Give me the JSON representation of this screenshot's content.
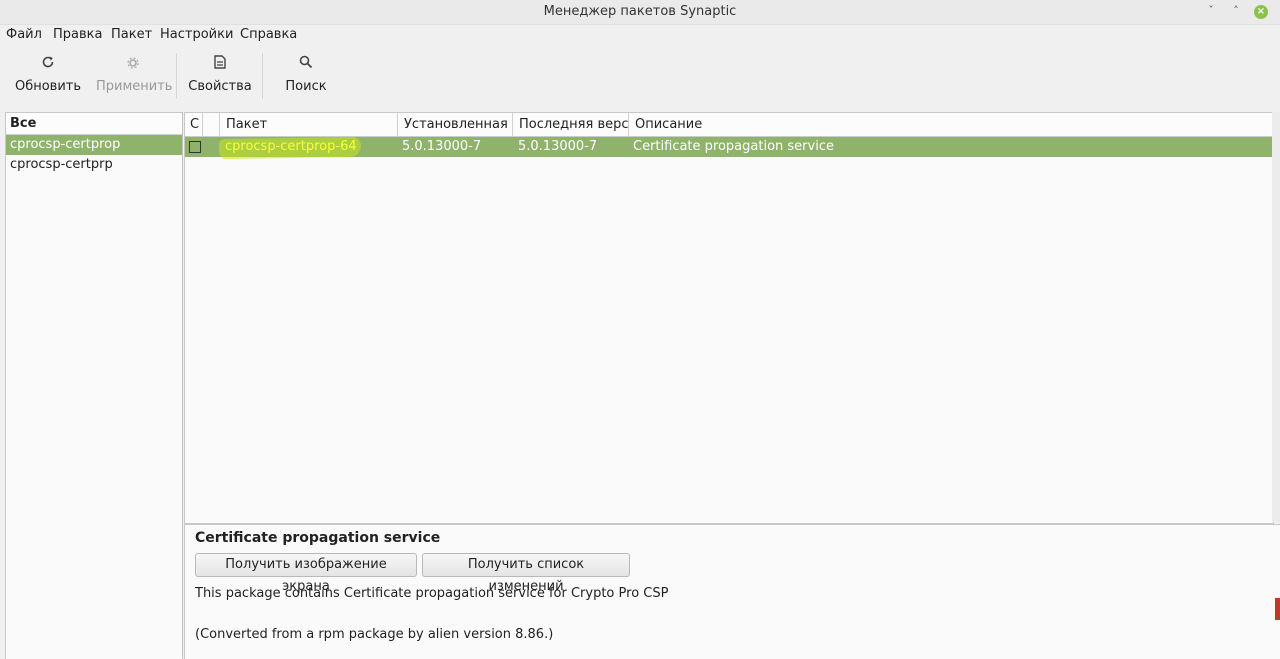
{
  "window": {
    "title": "Менеджер пакетов Synaptic",
    "controls": {
      "minimize": "ˇ",
      "maximize": "˄",
      "close": "×"
    }
  },
  "menubar": [
    "Файл",
    "Правка",
    "Пакет",
    "Настройки",
    "Справка"
  ],
  "toolbar": {
    "reload": {
      "label": "Обновить",
      "icon": "reload-icon"
    },
    "apply": {
      "label": "Применить",
      "icon": "gear-icon",
      "disabled": true
    },
    "properties": {
      "label": "Свойства",
      "icon": "document-icon"
    },
    "search": {
      "label": "Поиск",
      "icon": "search-icon"
    }
  },
  "filters": {
    "header": "Все",
    "items": [
      {
        "label": "cprocsp-certprop",
        "selected": true
      },
      {
        "label": "cprocsp-certprp",
        "selected": false
      }
    ]
  },
  "package_table": {
    "columns": [
      "С",
      "",
      "Пакет",
      "Установленная ве",
      "Последняя верси",
      "Описание"
    ],
    "rows": [
      {
        "package": "cprocsp-certprop-64",
        "installed_version": "5.0.13000-7",
        "latest_version": "5.0.13000-7",
        "description": "Certificate propagation service",
        "selected": true
      }
    ]
  },
  "details": {
    "title": "Certificate propagation service",
    "screenshot_button": "Получить изображение экрана",
    "changelog_button": "Получить список изменений",
    "description_line1": "This package contains Certificate propagation service for Crypto Pro CSP",
    "description_line2": "(Converted from a rpm package by alien version 8.86.)"
  },
  "colors": {
    "selection": "#8fb36a",
    "highlight_marker": "#c7e61c",
    "close_button": "#8bc34a"
  }
}
